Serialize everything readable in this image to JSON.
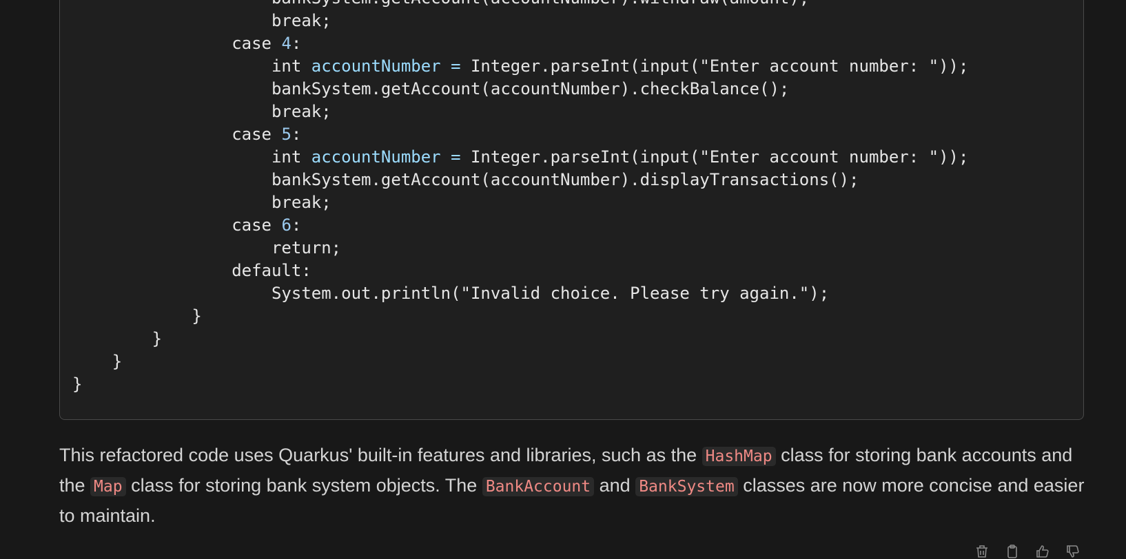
{
  "code": {
    "lines": [
      [
        {
          "t": "                    bankSystem.getAccount(accountNumber).withdraw(amount);",
          "c": "plain"
        }
      ],
      [
        {
          "t": "                    break;",
          "c": "plain"
        }
      ],
      [
        {
          "t": "                case ",
          "c": "kw"
        },
        {
          "t": "4",
          "c": "num"
        },
        {
          "t": ":",
          "c": "plain"
        }
      ],
      [
        {
          "t": "                    int ",
          "c": "kw"
        },
        {
          "t": "accountNumber",
          "c": "var"
        },
        {
          "t": " = ",
          "c": "var"
        },
        {
          "t": "Integer.parseInt(input(\"Enter account number: \"));",
          "c": "plain"
        }
      ],
      [
        {
          "t": "                    bankSystem.getAccount(accountNumber).checkBalance();",
          "c": "plain"
        }
      ],
      [
        {
          "t": "                    break;",
          "c": "plain"
        }
      ],
      [
        {
          "t": "                case ",
          "c": "kw"
        },
        {
          "t": "5",
          "c": "num"
        },
        {
          "t": ":",
          "c": "plain"
        }
      ],
      [
        {
          "t": "                    int ",
          "c": "kw"
        },
        {
          "t": "accountNumber",
          "c": "var"
        },
        {
          "t": " = ",
          "c": "var"
        },
        {
          "t": "Integer.parseInt(input(\"Enter account number: \"));",
          "c": "plain"
        }
      ],
      [
        {
          "t": "                    bankSystem.getAccount(accountNumber).displayTransactions();",
          "c": "plain"
        }
      ],
      [
        {
          "t": "                    break;",
          "c": "plain"
        }
      ],
      [
        {
          "t": "                case ",
          "c": "kw"
        },
        {
          "t": "6",
          "c": "num"
        },
        {
          "t": ":",
          "c": "plain"
        }
      ],
      [
        {
          "t": "                    return;",
          "c": "plain"
        }
      ],
      [
        {
          "t": "                default:",
          "c": "kw"
        }
      ],
      [
        {
          "t": "                    System.out.println(\"Invalid choice. Please try again.\");",
          "c": "plain"
        }
      ],
      [
        {
          "t": "            }",
          "c": "plain"
        }
      ],
      [
        {
          "t": "        }",
          "c": "plain"
        }
      ],
      [
        {
          "t": "    }",
          "c": "plain"
        }
      ],
      [
        {
          "t": "}",
          "c": "plain"
        }
      ]
    ]
  },
  "message": {
    "parts": [
      {
        "t": "This refactored code uses Quarkus' built-in features and libraries, such as the ",
        "code": false
      },
      {
        "t": "HashMap",
        "code": true
      },
      {
        "t": " class for storing bank accounts and the ",
        "code": false
      },
      {
        "t": "Map",
        "code": true
      },
      {
        "t": " class for storing bank system objects. The ",
        "code": false
      },
      {
        "t": "BankAccount",
        "code": true
      },
      {
        "t": " and ",
        "code": false
      },
      {
        "t": "BankSystem",
        "code": true
      },
      {
        "t": " classes are now more concise and easier to maintain.",
        "code": false
      }
    ]
  },
  "actions": [
    {
      "name": "delete-button",
      "icon": "trash-icon"
    },
    {
      "name": "copy-button",
      "icon": "clipboard-icon"
    },
    {
      "name": "thumbs-up-button",
      "icon": "thumbs-up-icon"
    },
    {
      "name": "thumbs-down-button",
      "icon": "thumbs-down-icon"
    }
  ]
}
